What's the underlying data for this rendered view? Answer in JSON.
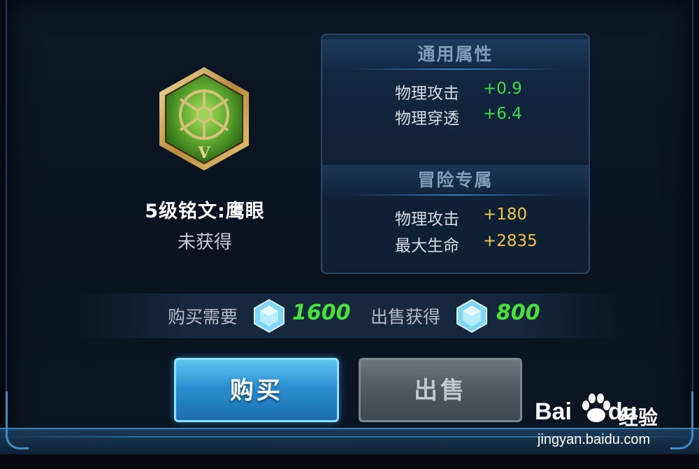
{
  "item": {
    "name": "5级铭文:鹰眼",
    "status": "未获得",
    "level_numeral": "V"
  },
  "attributes": {
    "general": {
      "title": "通用属性",
      "rows": [
        {
          "label": "物理攻击",
          "value": "+0.9"
        },
        {
          "label": "物理穿透",
          "value": "+6.4"
        }
      ]
    },
    "adventure": {
      "title": "冒险专属",
      "rows": [
        {
          "label": "物理攻击",
          "value": "+180"
        },
        {
          "label": "最大生命",
          "value": "+2835"
        }
      ]
    }
  },
  "price": {
    "buy_label": "购买需要",
    "buy_value": "1600",
    "sell_label": "出售获得",
    "sell_value": "800",
    "currency_icon": "crystal-gem-icon"
  },
  "buttons": {
    "buy": "购买",
    "sell": "出售"
  },
  "watermark": {
    "logo_text": "Bai",
    "logo_suffix": "du",
    "cn_text": "经验",
    "url": "jingyan.baidu.com"
  },
  "colors": {
    "positive_value": "#3ddc4a",
    "adventure_value": "#f3c24a",
    "price_value": "#47e23b",
    "buy_button": "#2a8fcf",
    "sell_button": "#4f585f"
  }
}
